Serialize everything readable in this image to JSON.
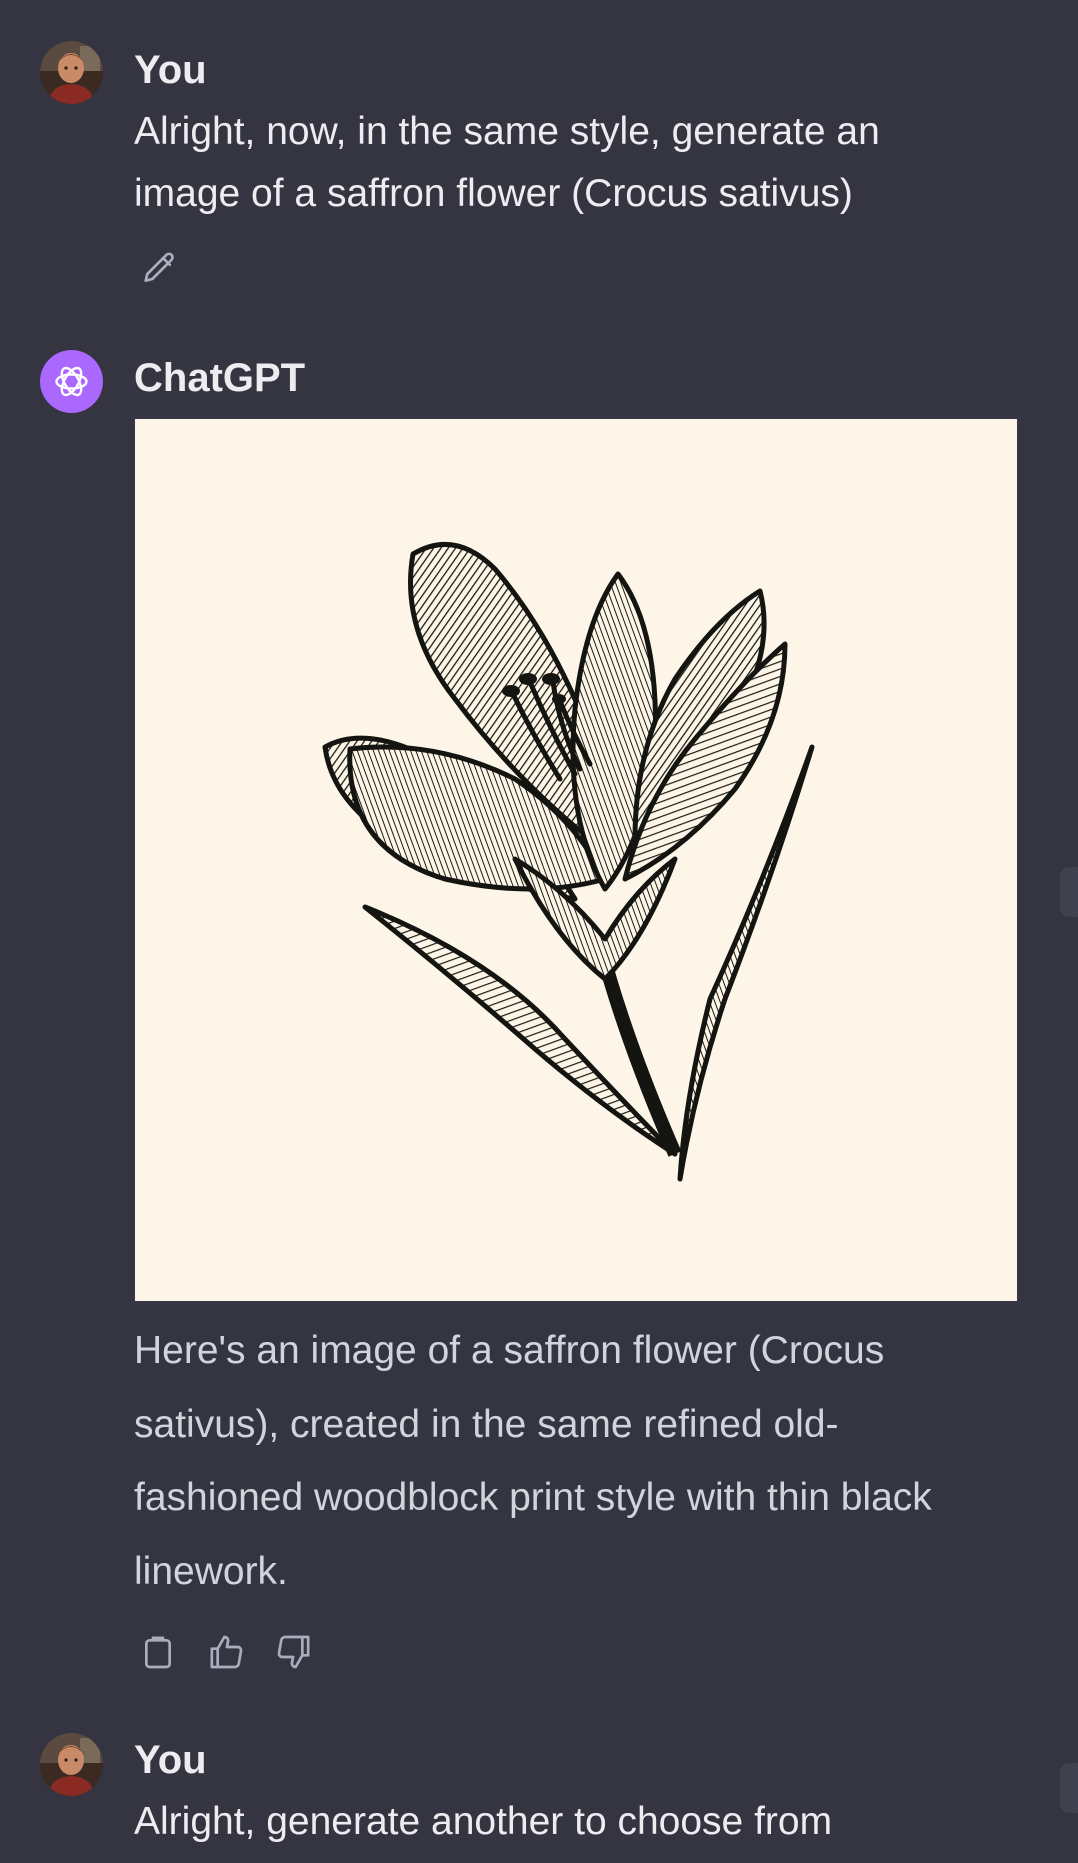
{
  "messages": [
    {
      "author": "You",
      "text": "Alright, now, in the same style, generate an image of a saffron flower (Crocus sativus)",
      "line1": "Alright, now, in the same style, generate an",
      "line2": "image of a saffron flower (Crocus sativus)"
    },
    {
      "author": "ChatGPT",
      "image_alt": "woodblock-style saffron flower illustration",
      "text": "Here's an image of a saffron flower (Crocus sativus), created in the same refined old-fashioned woodblock print style with thin black linework.",
      "lines": [
        "Here's an image of a saffron flower (Crocus",
        "sativus), created in the same refined old-",
        "fashioned woodblock print style with thin black",
        "linework."
      ]
    },
    {
      "author": "You",
      "text": "Alright, generate another to choose from"
    }
  ],
  "icons": {
    "edit": "pencil-icon",
    "copy": "clipboard-icon",
    "like": "thumbs-up-icon",
    "dislike": "thumbs-down-icon",
    "bot_logo": "openai-logo-icon"
  },
  "colors": {
    "background": "#343541",
    "bot_avatar": "#ab68ff",
    "image_background": "#fdf6e8"
  }
}
